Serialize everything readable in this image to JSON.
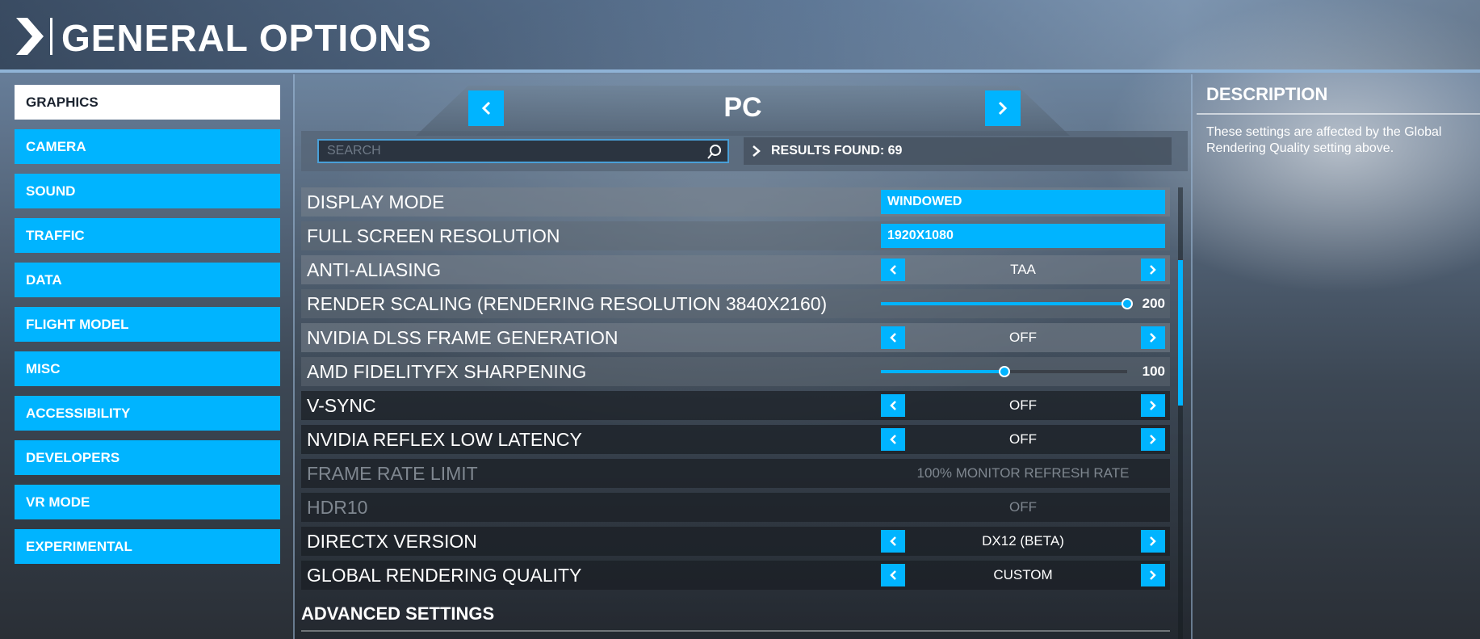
{
  "header": {
    "title": "GENERAL OPTIONS"
  },
  "sidebar": {
    "items": [
      {
        "label": "GRAPHICS",
        "active": true
      },
      {
        "label": "CAMERA"
      },
      {
        "label": "SOUND"
      },
      {
        "label": "TRAFFIC"
      },
      {
        "label": "DATA"
      },
      {
        "label": "FLIGHT MODEL"
      },
      {
        "label": "MISC"
      },
      {
        "label": "ACCESSIBILITY"
      },
      {
        "label": "DEVELOPERS"
      },
      {
        "label": "VR MODE"
      },
      {
        "label": "EXPERIMENTAL"
      }
    ]
  },
  "platform": {
    "label": "PC"
  },
  "search": {
    "placeholder": "SEARCH",
    "value": "",
    "results": "RESULTS FOUND: 69"
  },
  "settings": [
    {
      "label": "DISPLAY MODE",
      "type": "dropdown",
      "value": "WINDOWED"
    },
    {
      "label": "FULL SCREEN RESOLUTION",
      "type": "dropdown",
      "value": "1920X1080"
    },
    {
      "label": "ANTI-ALIASING",
      "type": "selector",
      "value": "TAA"
    },
    {
      "label": "RENDER SCALING (RENDERING RESOLUTION 3840X2160)",
      "type": "slider",
      "value": "200",
      "level": 1.0
    },
    {
      "label": "NVIDIA DLSS FRAME GENERATION",
      "type": "selector",
      "value": "OFF"
    },
    {
      "label": "AMD FIDELITYFX SHARPENING",
      "type": "slider",
      "value": "100",
      "level": 0.5
    },
    {
      "label": "V-SYNC",
      "type": "selector",
      "value": "OFF"
    },
    {
      "label": "NVIDIA REFLEX LOW LATENCY",
      "type": "selector",
      "value": "OFF"
    },
    {
      "label": "FRAME RATE LIMIT",
      "type": "disabled",
      "value": "100% MONITOR REFRESH RATE"
    },
    {
      "label": "HDR10",
      "type": "disabled",
      "value": "OFF"
    },
    {
      "label": "DIRECTX VERSION",
      "type": "selector",
      "value": "DX12 (BETA)"
    },
    {
      "label": "GLOBAL RENDERING QUALITY",
      "type": "selector",
      "value": "CUSTOM"
    }
  ],
  "advanced": {
    "label": "ADVANCED SETTINGS"
  },
  "description": {
    "title": "DESCRIPTION",
    "text": "These settings are affected by the Global Rendering Quality setting above."
  },
  "colors": {
    "accent": "#00b4ff",
    "active_bg": "#ffffff"
  },
  "icons": [
    "chevron-right-icon",
    "chevron-left-icon",
    "search-icon"
  ]
}
